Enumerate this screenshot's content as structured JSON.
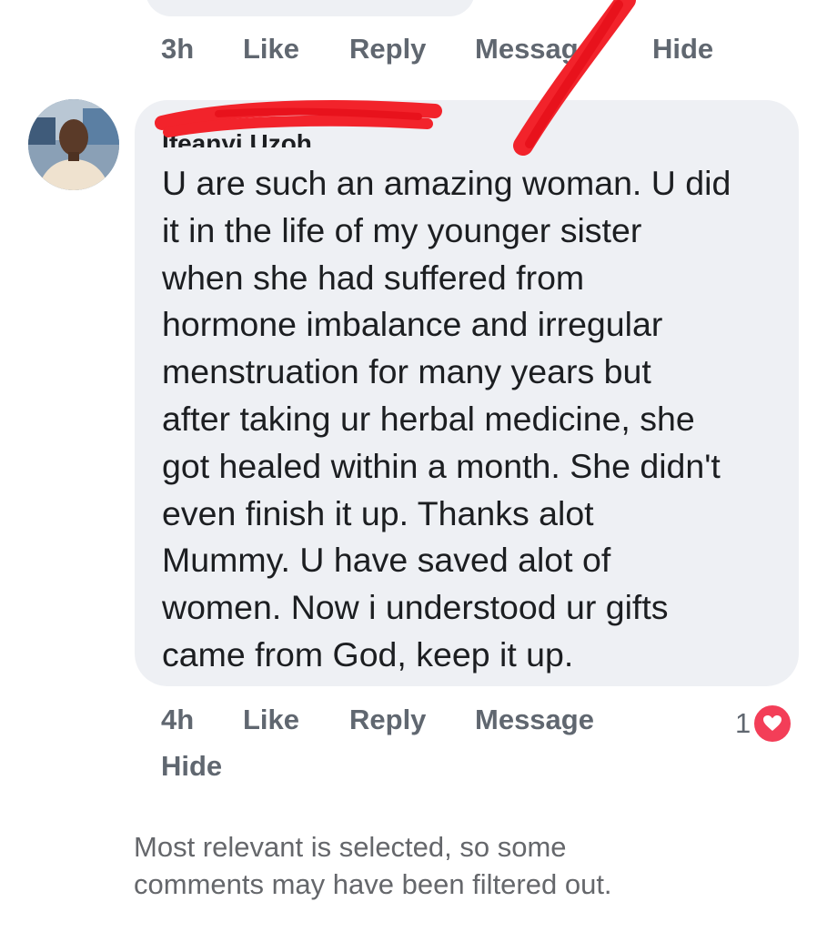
{
  "previous_comment": {
    "actions": {
      "time": "3h",
      "like": "Like",
      "reply": "Reply",
      "message": "Message",
      "hide": "Hide"
    }
  },
  "comment": {
    "author_name": "Ifeanyi Uzoh",
    "text": "U are such an amazing woman. U did\nit in the life of my younger sister\nwhen   she had suffered from\nhormone imbalance and irregular\nmenstruation for many years but\nafter taking ur herbal medicine, she\ngot healed within a month. She didn't\neven finish it up. Thanks alot\nMummy. U have saved alot of\nwomen. Now i understood ur gifts\ncame from God, keep it up.",
    "actions": {
      "time": "4h",
      "like": "Like",
      "reply": "Reply",
      "message": "Message",
      "hide": "Hide"
    },
    "reaction_count": "1",
    "reaction_icon": "heart-icon"
  },
  "filter_note": "Most relevant is selected, so some\ncomments may have been filtered out.",
  "colors": {
    "bubble": "#eef0f4",
    "action_text": "#606770",
    "heart": "#f33e58",
    "scribble": "#f2232b"
  }
}
